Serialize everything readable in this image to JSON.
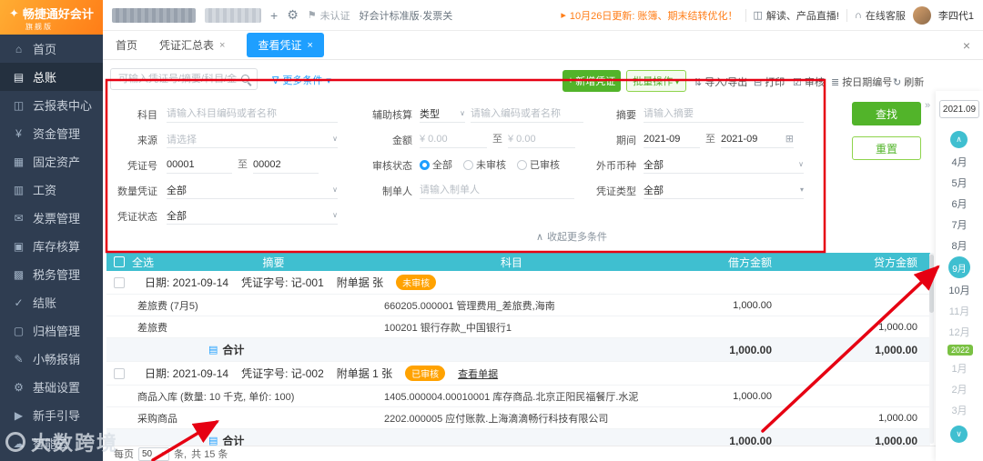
{
  "colors": {
    "sidebar_bg": "#2f3d51",
    "logo_orange": "#ff7d17",
    "accent_blue": "#1e9fff",
    "accent_teal": "#3fbfd0",
    "accent_green": "#52b42a",
    "status_orange": "#ffa200",
    "annotation_red": "#e60012"
  },
  "icons": {
    "logo": "✦",
    "home": "⌂",
    "ledger": "▤",
    "cloud_report": "◫",
    "funds": "¥",
    "fixed_assets": "▦",
    "salary": "▥",
    "invoice": "✉",
    "inventory": "▣",
    "tax": "▩",
    "closing": "✓",
    "archive": "▢",
    "reimburse": "✎",
    "settings": "⚙",
    "guide": "▶",
    "smart_cloud": "☁",
    "plus": "+",
    "gear": "⚙",
    "cert": "⚑",
    "horn": "▸",
    "tv": "◫",
    "headset": "∩",
    "funnel": "∇",
    "caret": "▾",
    "select_arrow": "∨",
    "import": "⇅",
    "print": "⊟",
    "audit": "☑",
    "bydate": "≣",
    "refresh": "↻",
    "calendar": "⊞",
    "collapse": "∧",
    "close": "×",
    "rail_toggle": "»",
    "up": "∧",
    "down": "∨",
    "doc": "▤"
  },
  "sidebar": {
    "logo_title": "畅捷通好会计",
    "logo_sub": "旗舰版",
    "items": [
      {
        "label": "首页"
      },
      {
        "label": "总账"
      },
      {
        "label": "云报表中心"
      },
      {
        "label": "资金管理"
      },
      {
        "label": "固定资产"
      },
      {
        "label": "工资"
      },
      {
        "label": "发票管理"
      },
      {
        "label": "库存核算"
      },
      {
        "label": "税务管理"
      },
      {
        "label": "结账"
      },
      {
        "label": "归档管理"
      },
      {
        "label": "小畅报销"
      },
      {
        "label": "基础设置"
      },
      {
        "label": "新手引导"
      },
      {
        "label": "智能云"
      }
    ]
  },
  "topbar": {
    "cert_label": "未认证",
    "edition_label": "好会计标准版·发票关",
    "announcement": "10月26日更新: 账簿、期末结转优化！",
    "live_label": "解读、产品直播!",
    "service_label": "在线客服",
    "user_name": "李四代1"
  },
  "tabs": {
    "items": [
      {
        "label": "首页"
      },
      {
        "label": "凭证汇总表"
      },
      {
        "label": "查看凭证"
      }
    ]
  },
  "toolbar": {
    "search_placeholder": "可输入凭证号/摘要/科目/金额...",
    "more_filters": "更多条件",
    "add_voucher": "新增凭证",
    "batch_ops": "批量操作",
    "import_export": "导入/导出",
    "print": "打印",
    "audit": "审核",
    "number_by_date": "按日期编号",
    "refresh": "刷新"
  },
  "filters": {
    "subject_label": "科目",
    "subject_placeholder": "请输入科目编码或者名称",
    "source_label": "来源",
    "source_placeholder": "请选择",
    "voucher_no_label": "凭证号",
    "voucher_no_from": "00001",
    "voucher_no_to": "00002",
    "qty_label": "数量凭证",
    "qty_value": "全部",
    "status_label": "凭证状态",
    "status_value": "全部",
    "aux_label": "辅助核算",
    "aux_type": "类型",
    "aux_placeholder": "请输入编码或者名称",
    "amount_label": "金额",
    "amount_from": "¥ 0.00",
    "amount_to": "¥ 0.00",
    "audit_label": "审核状态",
    "audit_options": [
      "全部",
      "未审核",
      "已审核"
    ],
    "preparer_label": "制单人",
    "preparer_placeholder": "请输入制单人",
    "summary_label": "摘要",
    "summary_placeholder": "请输入摘要",
    "period_label": "期间",
    "period_from": "2021-09",
    "period_to": "2021-09",
    "currency_label": "外币币种",
    "currency_value": "全部",
    "vtype_label": "凭证类型",
    "vtype_value": "全部",
    "to": "至",
    "collapse": "收起更多条件",
    "search": "查找",
    "reset": "重置"
  },
  "table": {
    "header": {
      "select_all": "全选",
      "summary": "摘要",
      "subject": "科目",
      "debit": "借方金额",
      "credit": "贷方金额"
    },
    "groups": [
      {
        "date": "日期: 2021-09-14",
        "voucher": "凭证字号: 记-001",
        "attach": "附单据 张",
        "status": "未审核",
        "rows": [
          {
            "summary": "差旅费 (7月5)",
            "subject": "660205.000001 管理费用_差旅费,海南",
            "debit": "1,000.00",
            "credit": ""
          },
          {
            "summary": "差旅费",
            "subject": "100201 银行存款_中国银行1",
            "debit": "",
            "credit": "1,000.00"
          }
        ],
        "total_label": "合计",
        "total_debit": "1,000.00",
        "total_credit": "1,000.00"
      },
      {
        "date": "日期: 2021-09-14",
        "voucher": "凭证字号: 记-002",
        "attach": "附单据 1 张",
        "status": "已审核",
        "view_docs": "查看单据",
        "rows": [
          {
            "summary": "商品入库 (数量: 10 千克, 单价: 100)",
            "subject": "1405.000004.00010001 库存商品.北京正阳民福餐厅.水泥",
            "debit": "1,000.00",
            "credit": ""
          },
          {
            "summary": "采购商品",
            "subject": "2202.000005 应付账款.上海滴滴畅行科技有限公司",
            "debit": "",
            "credit": "1,000.00"
          }
        ],
        "total_label": "合计",
        "total_debit": "1,000.00",
        "total_credit": "1,000.00"
      }
    ]
  },
  "pagination": {
    "per_page": "每页",
    "page_size": "50",
    "unit": "条,",
    "total": "共 15 条"
  },
  "period_rail": {
    "current": "2021.09",
    "months": [
      "4月",
      "5月",
      "6月",
      "7月",
      "8月",
      "9月",
      "10月",
      "11月",
      "12月",
      "2022",
      "1月",
      "2月",
      "3月"
    ]
  },
  "watermark": {
    "text": "大数跨境"
  }
}
